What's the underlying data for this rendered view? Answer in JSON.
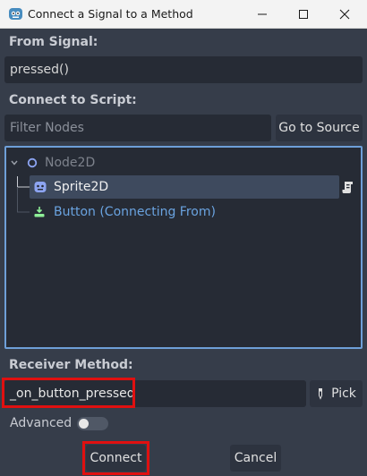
{
  "window": {
    "title": "Connect a Signal to a Method",
    "app_icon": "godot-icon",
    "controls": [
      "minimize-icon",
      "maximize-icon",
      "close-icon"
    ]
  },
  "from_signal": {
    "label": "From Signal:",
    "value": "pressed()"
  },
  "connect_to_script": {
    "label": "Connect to Script:",
    "filter_placeholder": "Filter Nodes",
    "go_to_source_label": "Go to Source"
  },
  "tree": {
    "nodes": [
      {
        "label": "Node2D",
        "icon": "node2d-icon",
        "state": "disabled"
      },
      {
        "label": "Sprite2D",
        "icon": "sprite2d-icon",
        "state": "selected",
        "badge_icon": "script-icon"
      },
      {
        "label": "Button (Connecting From)",
        "icon": "button-node-icon",
        "state": "source"
      }
    ]
  },
  "receiver": {
    "label": "Receiver Method:",
    "value": "_on_button_pressed",
    "pick_label": "Pick",
    "pick_icon": "eyedropper-icon"
  },
  "advanced": {
    "label": "Advanced",
    "enabled": false
  },
  "footer": {
    "connect_label": "Connect",
    "cancel_label": "Cancel"
  },
  "colors": {
    "background": "#363d4a",
    "field": "#262b35",
    "accent": "#6e9fd8",
    "highlight": "#e01010",
    "source_text": "#6aa3e0"
  }
}
